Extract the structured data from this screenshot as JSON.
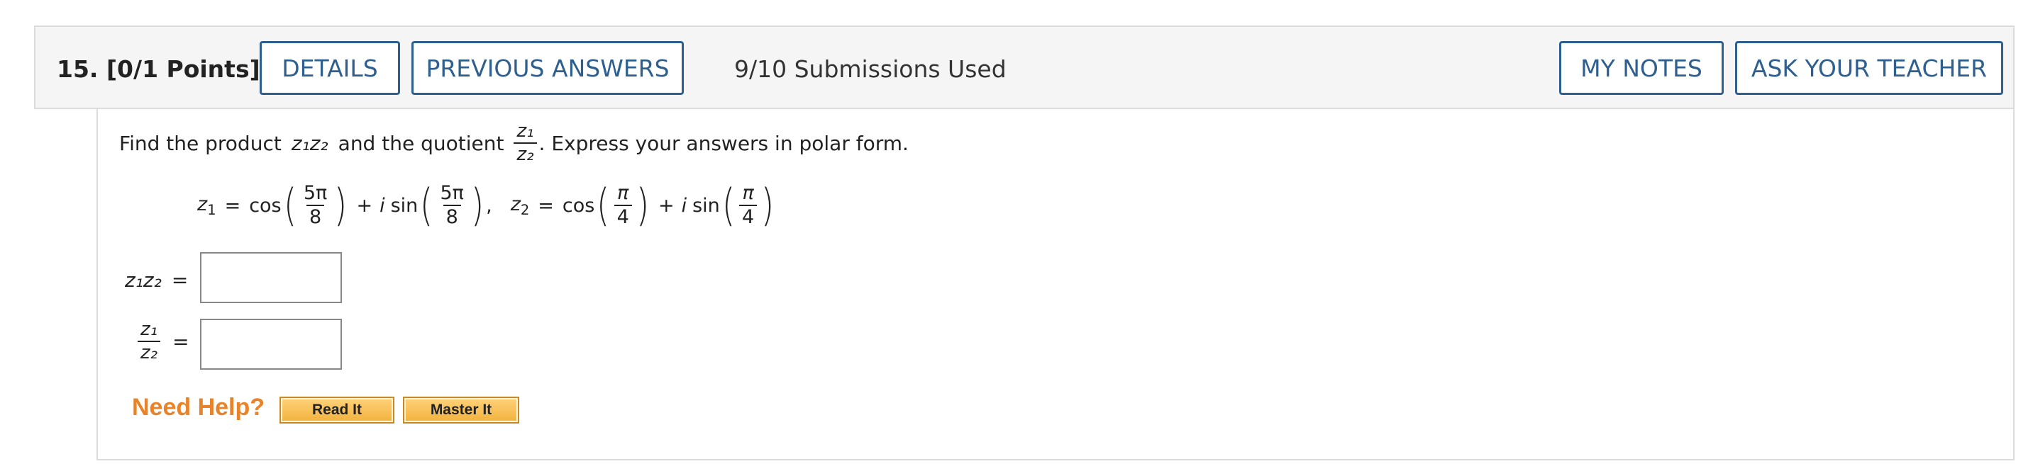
{
  "question": {
    "number": "15.",
    "points": "[0/1 Points]",
    "details_label": "DETAILS",
    "previous_answers_label": "PREVIOUS ANSWERS",
    "submissions": "9/10 Submissions Used",
    "my_notes_label": "MY NOTES",
    "ask_teacher_label": "ASK YOUR TEACHER"
  },
  "prompt": {
    "before": "Find the product",
    "product": "z₁z₂",
    "middle": "and the quotient",
    "quotient_num": "z₁",
    "quotient_den": "z₂",
    "after": ". Express your answers in polar form."
  },
  "equations": {
    "z1_label": "z",
    "z1_sub": "1",
    "z2_label": "z",
    "z2_sub": "2",
    "equals": "=",
    "cos": "cos",
    "sin": "sin",
    "plus": "+",
    "i": "i",
    "z1_num": "5π",
    "z1_den": "8",
    "z2_num": "π",
    "z2_den": "4",
    "comma": ","
  },
  "answers": {
    "product_label": "z₁z₂",
    "quotient_num": "z₁",
    "quotient_den": "z₂",
    "equals": "=",
    "product_value": "",
    "quotient_value": ""
  },
  "help": {
    "need_help": "Need Help?",
    "read_it": "Read It",
    "master_it": "Master It"
  },
  "colors": {
    "button_blue": "#2e5f8f",
    "need_help_orange": "#e8832a",
    "help_button_gold": "#f2b23c"
  }
}
